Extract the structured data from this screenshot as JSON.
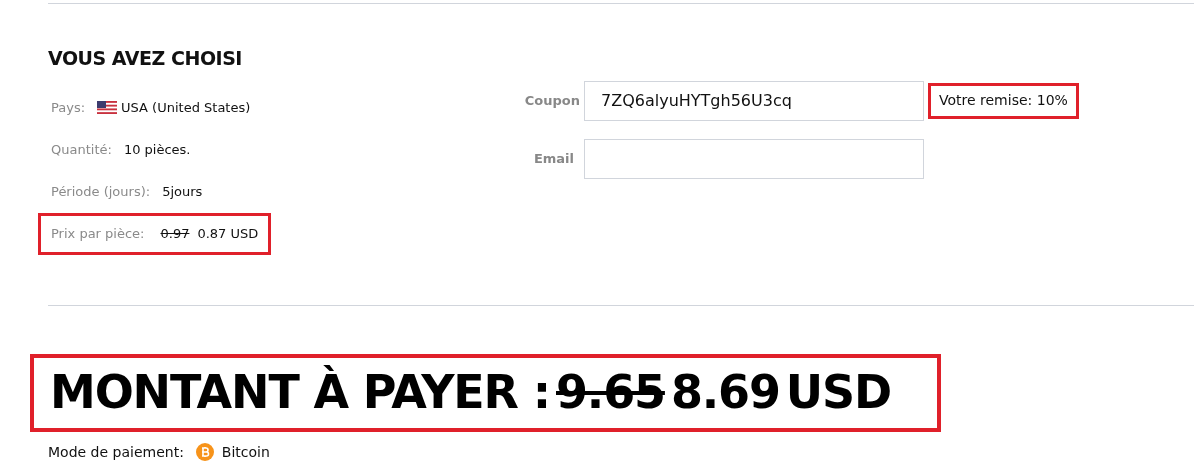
{
  "heading": "VOUS AVEZ CHOISI",
  "details": [
    {
      "label": "Pays:",
      "value": "USA (United States)",
      "kind": "country"
    },
    {
      "label": "Quantité:",
      "value": "10 pièces.",
      "kind": "plain"
    },
    {
      "label": "Période (jours):",
      "value": "5jours",
      "kind": "plain"
    },
    {
      "label": "Prix par pièce:",
      "old_value": "0.97",
      "value": "0.87 USD",
      "kind": "price",
      "highlighted": true
    }
  ],
  "coupon": {
    "label": "Coupon",
    "value": "7ZQ6alyuHYTgh56U3cq"
  },
  "discount": {
    "text": "Votre remise: 10%",
    "highlighted": true
  },
  "email": {
    "label": "Email"
  },
  "total": {
    "label": "MONTANT À PAYER :",
    "old_value": "9.65",
    "value": "8.69",
    "currency": "USD",
    "highlighted": true
  },
  "payment": {
    "label": "Mode de paiement:",
    "method": "Bitcoin"
  }
}
